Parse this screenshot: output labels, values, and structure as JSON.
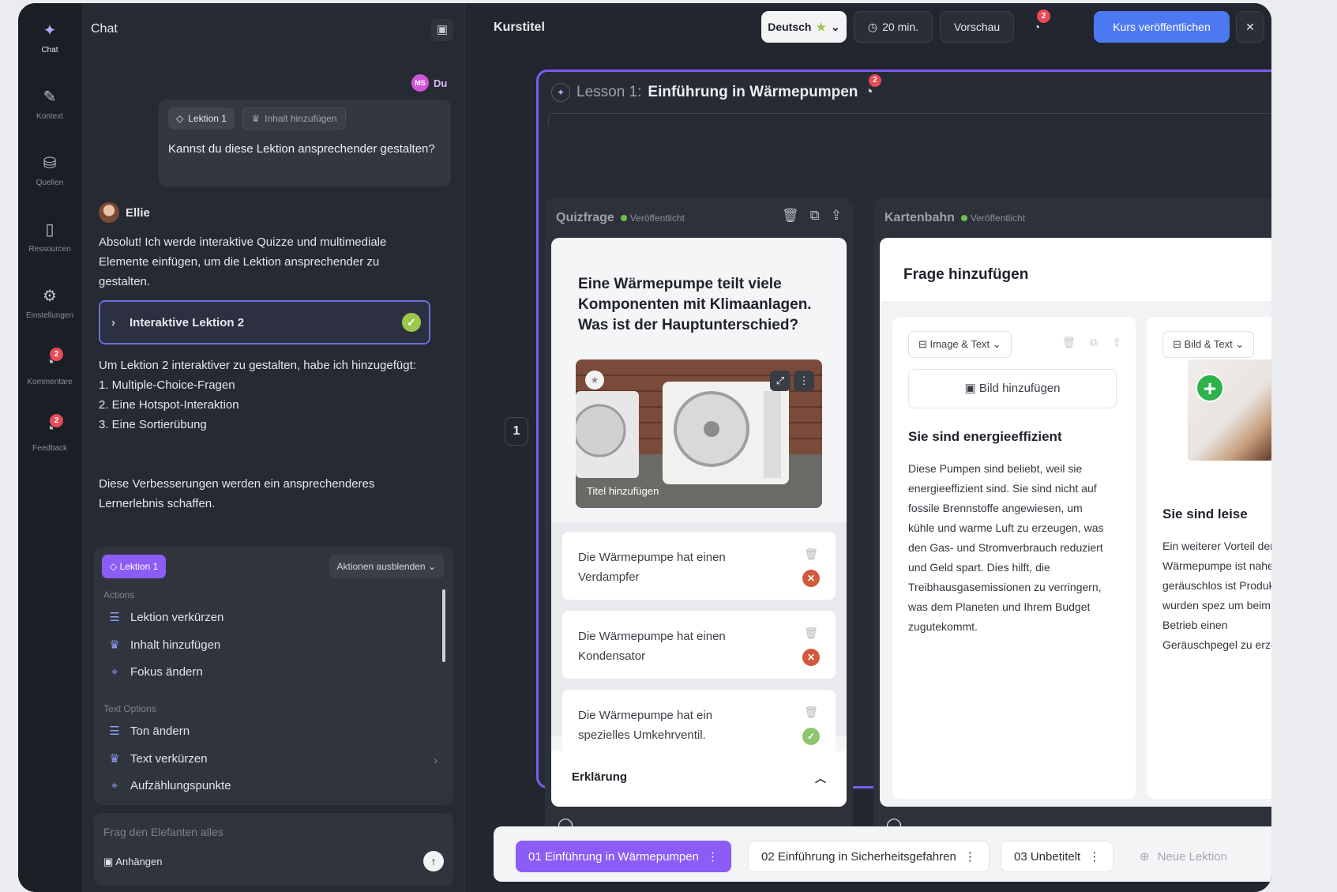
{
  "rail": [
    {
      "label": "Chat",
      "icon": "sparkle-icon"
    },
    {
      "label": "Kontext",
      "icon": "pin-icon"
    },
    {
      "label": "Quellen",
      "icon": "database-icon"
    },
    {
      "label": "Ressourcen",
      "icon": "file-icon"
    },
    {
      "label": "Einstellungen",
      "icon": "gear-icon"
    },
    {
      "label": "Kommentare",
      "icon": "comment-icon",
      "badge": "2"
    },
    {
      "label": "Feedback",
      "icon": "feedback-icon",
      "badge": "2"
    }
  ],
  "chat": {
    "title": "Chat",
    "user_label": "Du",
    "user_initials": "MS",
    "user_chip_lesson": "Lektion 1",
    "user_chip_add": "Inhalt hinzufügen",
    "user_message": "Kannst du diese Lektion ansprechender gestalten?",
    "bot_name": "Ellie",
    "bot_message_1": "Absolut! Ich werde interaktive Quizze und multimediale Elemente einfügen, um die Lektion ansprechender zu gestalten.",
    "lesson_card": "Interaktive Lektion 2",
    "bot_message_2_lines": [
      "Um Lektion 2 interaktiver zu gestalten, habe ich hinzugefügt:",
      "1. Multiple-Choice-Fragen",
      "2. Eine Hotspot-Interaktion",
      "3. Eine Sortierübung"
    ],
    "bot_message_3": "Diese Verbesserungen werden ein ansprechenderes Lernerlebnis schaffen.",
    "actions": {
      "chip": "Lektion 1",
      "hide": "Aktionen ausblenden",
      "head_actions": "Actions",
      "items_actions": [
        "Lektion verkürzen",
        "Inhalt hinzufügen",
        "Fokus ändern"
      ],
      "head_text": "Text Options",
      "items_text": [
        "Ton ändern",
        "Text verkürzen",
        "Aufzählungspunkte"
      ]
    },
    "ask_placeholder": "Frag den Elefanten alles",
    "attach": "Anhängen"
  },
  "topbar": {
    "course_title": "Kurstitel",
    "language": "Deutsch",
    "duration": "20 min.",
    "preview": "Vorschau",
    "comments_badge": "2",
    "publish": "Kurs veröffentlichen"
  },
  "lesson": {
    "prefix": "Lesson 1:",
    "title": "Einführung in Wärmepumpen",
    "badge": "2",
    "page": "1"
  },
  "quiz": {
    "label": "Quizfrage",
    "status": "Veröffentlicht",
    "question": "Eine Wärmepumpe teilt viele Komponenten mit Klimaanlagen. Was ist der Hauptunterschied?",
    "image_caption": "Titel hinzufügen",
    "answers": [
      {
        "text": "Die Wärmepumpe hat einen Verdampfer",
        "correct": false
      },
      {
        "text": "Die Wärmepumpe hat einen Kondensator",
        "correct": false
      },
      {
        "text": "Die Wärmepumpe hat ein spezielles Umkehrventil.",
        "correct": true
      }
    ],
    "explanation": "Erklärung"
  },
  "cards": {
    "label": "Kartenbahn",
    "status": "Veröffentlicht",
    "title": "Frage hinzufügen",
    "slide1": {
      "type": "Image & Text",
      "add_image": "Bild hinzufügen",
      "heading": "Sie sind energieeffizient",
      "body": "Diese Pumpen sind beliebt, weil sie energieeffizient sind. Sie sind nicht auf fossile Brennstoffe angewiesen, um kühle und warme Luft zu erzeugen, was den Gas- und Stromverbrauch reduziert und Geld spart. Dies hilft, die Treibhausgasemissionen zu verringern, was dem Planeten und Ihrem Budget zugutekommt."
    },
    "slide2": {
      "type": "Bild & Text",
      "heading": "Sie sind leise",
      "body": "Ein weiterer Vorteil der einer Wärmepumpe ist nahezu geräuschlos ist Produkte wurden spez um beim Betrieb einen Geräuschpegel zu erze"
    }
  },
  "tabs": [
    {
      "label": "01 Einführung in Wärmepumpen",
      "active": true
    },
    {
      "label": "02 Einführung in Sicherheitsgefahren",
      "active": false
    },
    {
      "label": "03 Unbetitelt",
      "active": false
    }
  ],
  "new_lesson": "Neue Lektion",
  "colors": {
    "accent": "#8b5cf6",
    "publish": "#4c79f2",
    "badge": "#e84b57"
  }
}
